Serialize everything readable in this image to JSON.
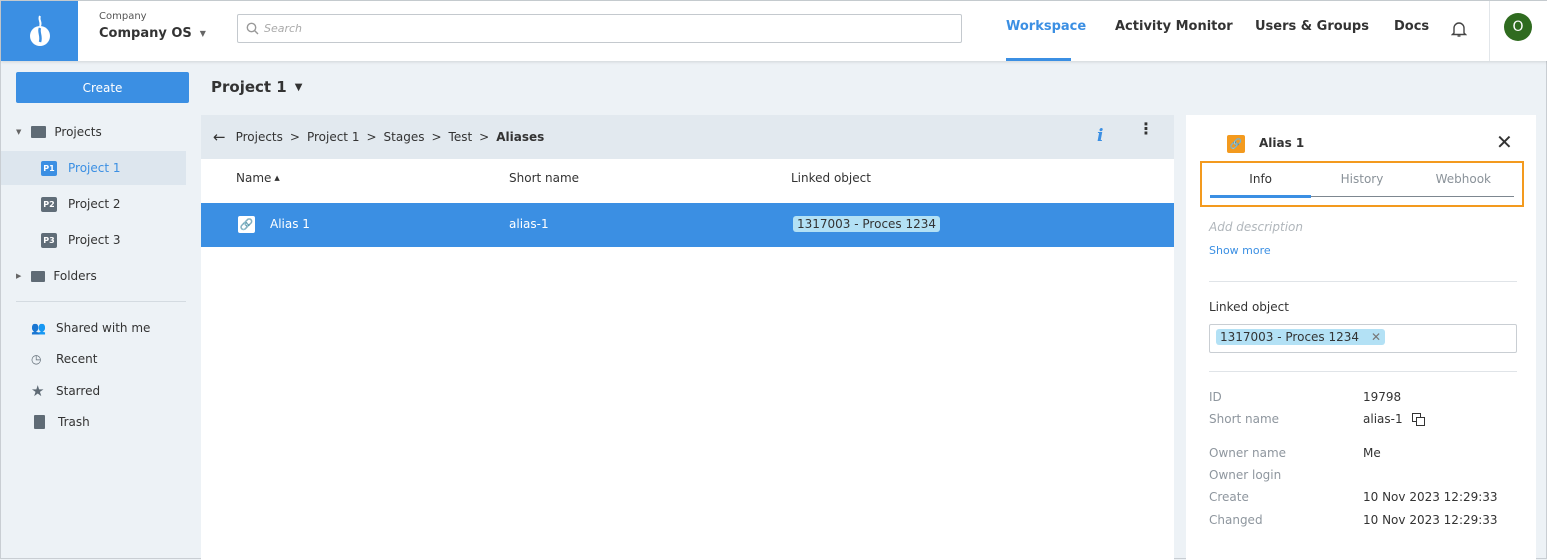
{
  "header": {
    "company_label": "Company",
    "company_name": "Company OS",
    "search_placeholder": "Search",
    "nav": [
      "Workspace",
      "Activity Monitor",
      "Users & Groups",
      "Docs"
    ],
    "active_nav": "Workspace",
    "avatar": "O"
  },
  "sidebar": {
    "create_label": "Create",
    "projects_label": "Projects",
    "projects": [
      {
        "badge": "P1",
        "label": "Project 1"
      },
      {
        "badge": "P2",
        "label": "Project 2"
      },
      {
        "badge": "P3",
        "label": "Project 3"
      }
    ],
    "folders_label": "Folders",
    "links": [
      "Shared with me",
      "Recent",
      "Starred",
      "Trash"
    ]
  },
  "project_selector": "Project 1",
  "breadcrumb": [
    "Projects",
    "Project 1",
    "Stages",
    "Test",
    "Aliases"
  ],
  "table": {
    "columns": [
      "Name",
      "Short name",
      "Linked object"
    ],
    "rows": [
      {
        "name": "Alias 1",
        "short_name": "alias-1",
        "linked": "1317003 - Proces 1234"
      }
    ]
  },
  "panel": {
    "title": "Alias 1",
    "tabs": [
      "Info",
      "History",
      "Webhook"
    ],
    "active_tab": "Info",
    "description_placeholder": "Add description",
    "show_more": "Show more",
    "linked_label": "Linked object",
    "linked_tag": "1317003 - Proces 1234",
    "props": [
      {
        "label": "ID",
        "value": "19798"
      },
      {
        "label": "Short name",
        "value": "alias-1"
      },
      {
        "label": "Owner name",
        "value": "Me"
      },
      {
        "label": "Owner login",
        "value": ""
      },
      {
        "label": "Create",
        "value": "10 Nov 2023 12:29:33"
      },
      {
        "label": "Changed",
        "value": "10 Nov 2023 12:29:33"
      }
    ]
  },
  "colors": {
    "accent": "#3b8fe3",
    "highlight": "#f39a1e",
    "tag": "#b3e1f5"
  }
}
